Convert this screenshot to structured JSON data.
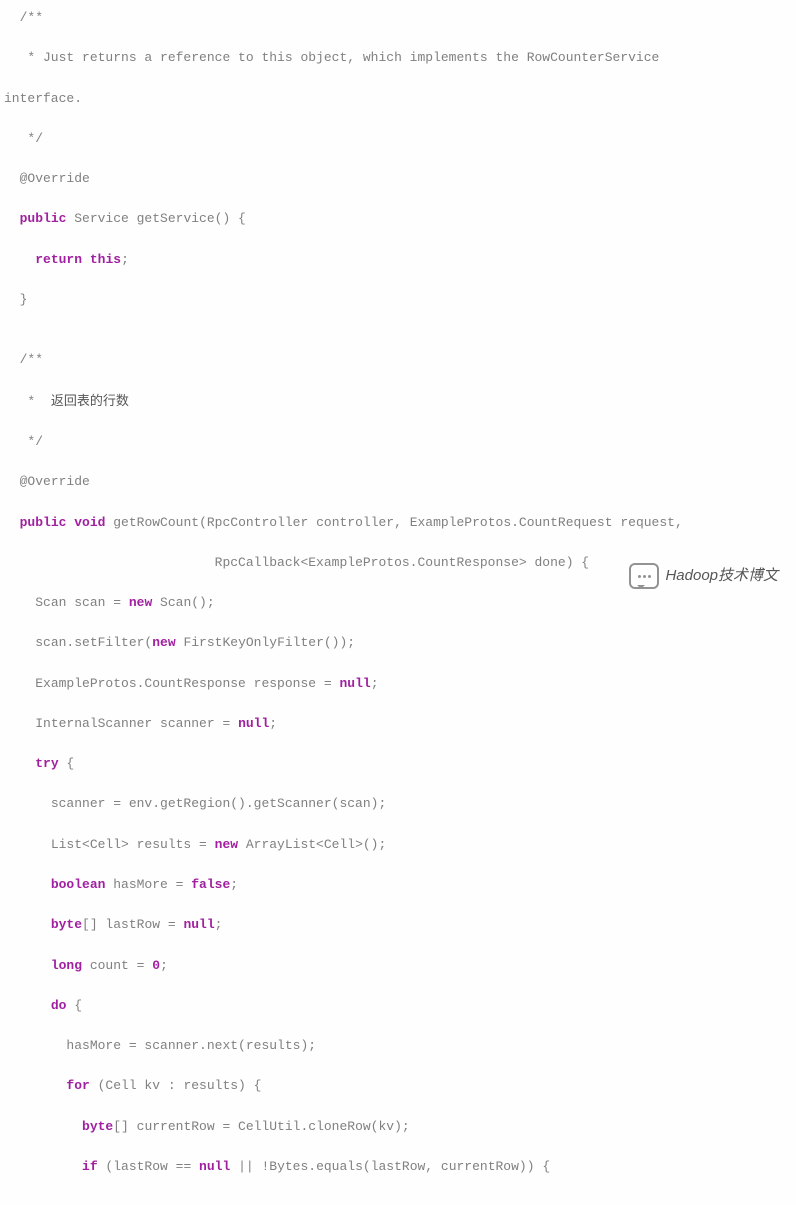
{
  "code": {
    "lines": [
      {
        "indent": "  ",
        "segs": [
          {
            "c": "cmt",
            "t": "/**"
          }
        ]
      },
      {
        "indent": "   ",
        "segs": [
          {
            "c": "cmt",
            "t": "* Just returns a reference to this object, which implements the RowCounterService"
          }
        ]
      },
      {
        "indent": "",
        "segs": [
          {
            "c": "cmt",
            "t": "interface."
          }
        ]
      },
      {
        "indent": "   ",
        "segs": [
          {
            "c": "cmt",
            "t": "*/"
          }
        ]
      },
      {
        "indent": "  ",
        "segs": [
          {
            "c": "txt",
            "t": "@Override"
          }
        ]
      },
      {
        "indent": "  ",
        "segs": [
          {
            "c": "kw",
            "t": "public"
          },
          {
            "c": "txt",
            "t": " Service getService() {"
          }
        ]
      },
      {
        "indent": "    ",
        "segs": [
          {
            "c": "kw",
            "t": "return"
          },
          {
            "c": "txt",
            "t": " "
          },
          {
            "c": "lit",
            "t": "this"
          },
          {
            "c": "txt",
            "t": ";"
          }
        ]
      },
      {
        "indent": "  ",
        "segs": [
          {
            "c": "txt",
            "t": "}"
          }
        ]
      },
      {
        "indent": "",
        "segs": [
          {
            "c": "txt",
            "t": ""
          }
        ]
      },
      {
        "indent": "  ",
        "segs": [
          {
            "c": "cmt",
            "t": "/**"
          }
        ]
      },
      {
        "indent": "   ",
        "segs": [
          {
            "c": "cmt",
            "t": "*  "
          },
          {
            "c": "cjk",
            "t": "返回表的行数"
          }
        ]
      },
      {
        "indent": "   ",
        "segs": [
          {
            "c": "cmt",
            "t": "*/"
          }
        ]
      },
      {
        "indent": "  ",
        "segs": [
          {
            "c": "txt",
            "t": "@Override"
          }
        ]
      },
      {
        "indent": "  ",
        "segs": [
          {
            "c": "kw",
            "t": "public"
          },
          {
            "c": "txt",
            "t": " "
          },
          {
            "c": "kw",
            "t": "void"
          },
          {
            "c": "txt",
            "t": " getRowCount(RpcController controller, ExampleProtos.CountRequest request,"
          }
        ]
      },
      {
        "indent": "                           ",
        "segs": [
          {
            "c": "txt",
            "t": "RpcCallback<ExampleProtos.CountResponse> done) {"
          }
        ]
      },
      {
        "indent": "    ",
        "segs": [
          {
            "c": "txt",
            "t": "Scan scan = "
          },
          {
            "c": "kw",
            "t": "new"
          },
          {
            "c": "txt",
            "t": " Scan();"
          }
        ]
      },
      {
        "indent": "    ",
        "segs": [
          {
            "c": "txt",
            "t": "scan.setFilter("
          },
          {
            "c": "kw",
            "t": "new"
          },
          {
            "c": "txt",
            "t": " FirstKeyOnlyFilter());"
          }
        ]
      },
      {
        "indent": "    ",
        "segs": [
          {
            "c": "txt",
            "t": "ExampleProtos.CountResponse response = "
          },
          {
            "c": "lit",
            "t": "null"
          },
          {
            "c": "txt",
            "t": ";"
          }
        ]
      },
      {
        "indent": "    ",
        "segs": [
          {
            "c": "txt",
            "t": "InternalScanner scanner = "
          },
          {
            "c": "lit",
            "t": "null"
          },
          {
            "c": "txt",
            "t": ";"
          }
        ]
      },
      {
        "indent": "    ",
        "segs": [
          {
            "c": "kw",
            "t": "try"
          },
          {
            "c": "txt",
            "t": " {"
          }
        ]
      },
      {
        "indent": "      ",
        "segs": [
          {
            "c": "txt",
            "t": "scanner = env.getRegion().getScanner(scan);"
          }
        ]
      },
      {
        "indent": "      ",
        "segs": [
          {
            "c": "txt",
            "t": "List<Cell> results = "
          },
          {
            "c": "kw",
            "t": "new"
          },
          {
            "c": "txt",
            "t": " ArrayList<Cell>();"
          }
        ]
      },
      {
        "indent": "      ",
        "segs": [
          {
            "c": "kw",
            "t": "boolean"
          },
          {
            "c": "txt",
            "t": " hasMore = "
          },
          {
            "c": "lit",
            "t": "false"
          },
          {
            "c": "txt",
            "t": ";"
          }
        ]
      },
      {
        "indent": "      ",
        "segs": [
          {
            "c": "kw",
            "t": "byte"
          },
          {
            "c": "txt",
            "t": "[] lastRow = "
          },
          {
            "c": "lit",
            "t": "null"
          },
          {
            "c": "txt",
            "t": ";"
          }
        ]
      },
      {
        "indent": "      ",
        "segs": [
          {
            "c": "kw",
            "t": "long"
          },
          {
            "c": "txt",
            "t": " count = "
          },
          {
            "c": "lit",
            "t": "0"
          },
          {
            "c": "txt",
            "t": ";"
          }
        ]
      },
      {
        "indent": "      ",
        "segs": [
          {
            "c": "kw",
            "t": "do"
          },
          {
            "c": "txt",
            "t": " {"
          }
        ]
      },
      {
        "indent": "        ",
        "segs": [
          {
            "c": "txt",
            "t": "hasMore = scanner.next(results);"
          }
        ]
      },
      {
        "indent": "        ",
        "segs": [
          {
            "c": "kw",
            "t": "for"
          },
          {
            "c": "txt",
            "t": " (Cell kv : results) {"
          }
        ]
      },
      {
        "indent": "          ",
        "segs": [
          {
            "c": "kw",
            "t": "byte"
          },
          {
            "c": "txt",
            "t": "[] currentRow = CellUtil.cloneRow(kv);"
          }
        ]
      },
      {
        "indent": "          ",
        "segs": [
          {
            "c": "kw",
            "t": "if"
          },
          {
            "c": "txt",
            "t": " (lastRow == "
          },
          {
            "c": "lit",
            "t": "null"
          },
          {
            "c": "txt",
            "t": " || !Bytes.equals(lastRow, currentRow)) {"
          }
        ]
      }
    ]
  },
  "watermark": {
    "label": "Hadoop技术博文"
  }
}
